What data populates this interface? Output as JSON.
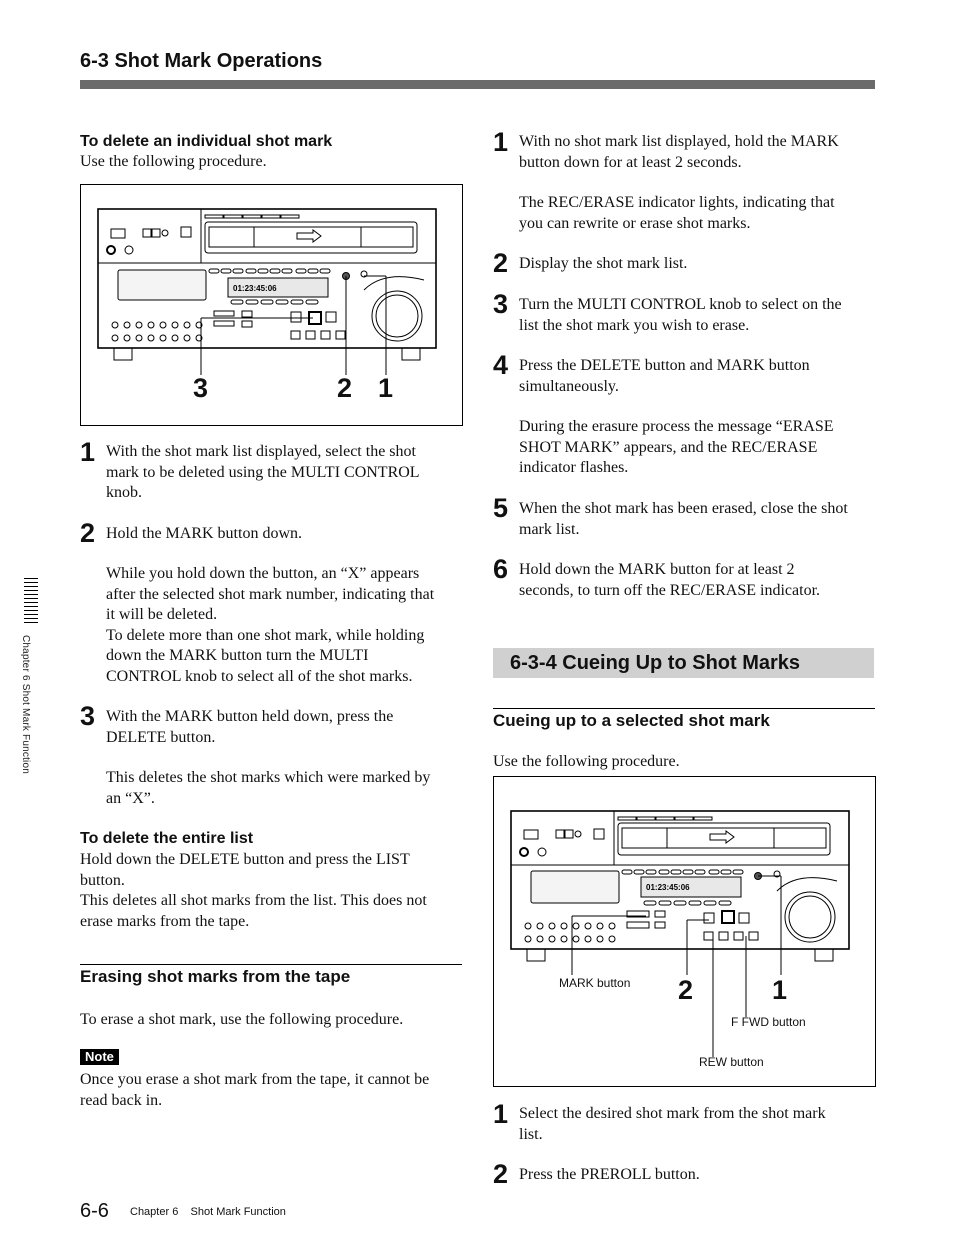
{
  "header": {
    "title": "6-3  Shot Mark Operations"
  },
  "left": {
    "delete_individual": {
      "heading": "To delete an individual shot mark",
      "intro": "Use the following procedure.",
      "figure": {
        "callouts": [
          "3",
          "2",
          "1"
        ],
        "timecode": "01:23:45:06"
      },
      "steps": [
        {
          "num": "1",
          "lines": [
            "With the shot mark list displayed, select the shot",
            "mark to be deleted using the MULTI CONTROL",
            "knob."
          ]
        },
        {
          "num": "2",
          "lines": [
            "Hold the MARK button down."
          ],
          "extra": [
            "While you hold down the button, an “X” appears",
            "after the selected shot mark number, indicating that",
            "it will be deleted.",
            "To delete more than one shot mark, while holding",
            "down the MARK button turn the MULTI",
            "CONTROL knob to select all of the shot marks."
          ]
        },
        {
          "num": "3",
          "lines": [
            "With the MARK button held down, press the",
            "DELETE button."
          ],
          "extra": [
            "This deletes the shot marks which were marked by",
            "an “X”."
          ]
        }
      ]
    },
    "delete_entire": {
      "heading": "To delete the entire list",
      "lines": [
        "Hold down the DELETE button and press the LIST",
        "button.",
        "This deletes all shot marks from the list. This does not",
        "erase marks from the tape."
      ]
    },
    "erasing": {
      "heading": "Erasing shot marks from the tape",
      "intro": "To erase a shot mark, use the following procedure.",
      "note_label": "Note",
      "note_lines": [
        "Once you erase a shot mark from the tape, it cannot be",
        "read back in."
      ]
    }
  },
  "right": {
    "erase_steps": [
      {
        "num": "1",
        "lines": [
          "With no shot mark list displayed, hold the MARK",
          "button down for at least 2 seconds."
        ],
        "extra": [
          "The REC/ERASE indicator lights, indicating that",
          "you can rewrite or erase shot marks."
        ]
      },
      {
        "num": "2",
        "lines": [
          "Display the shot mark list."
        ]
      },
      {
        "num": "3",
        "lines": [
          "Turn the MULTI CONTROL knob to select on the",
          "list the shot mark you wish to erase."
        ]
      },
      {
        "num": "4",
        "lines": [
          "Press the DELETE button and MARK button",
          "simultaneously."
        ],
        "extra": [
          "During the erasure process the message “ERASE",
          "SHOT MARK” appears, and the REC/ERASE",
          "indicator flashes."
        ]
      },
      {
        "num": "5",
        "lines": [
          "When the shot mark has been erased, close the shot",
          "mark list."
        ]
      },
      {
        "num": "6",
        "lines": [
          "Hold down the MARK button for at least 2",
          "seconds, to turn off the REC/ERASE indicator."
        ]
      }
    ],
    "cueing": {
      "section_title": "6-3-4  Cueing Up to Shot Marks",
      "heading": "Cueing up to a selected shot mark",
      "intro": "Use the following procedure.",
      "figure": {
        "timecode": "01:23:45:06",
        "callouts": [
          "2",
          "1"
        ],
        "labels": {
          "mark": "MARK button",
          "ffwd": "F FWD button",
          "rew": "REW button"
        }
      },
      "steps": [
        {
          "num": "1",
          "lines": [
            "Select the desired shot mark from the shot mark",
            "list."
          ]
        },
        {
          "num": "2",
          "lines": [
            "Press the PREROLL button."
          ]
        }
      ]
    }
  },
  "sidebar": {
    "label": "Chapter 6   Shot Mark Function"
  },
  "footer": {
    "page": "6-6",
    "chapter": "Chapter 6    Shot Mark Function"
  }
}
